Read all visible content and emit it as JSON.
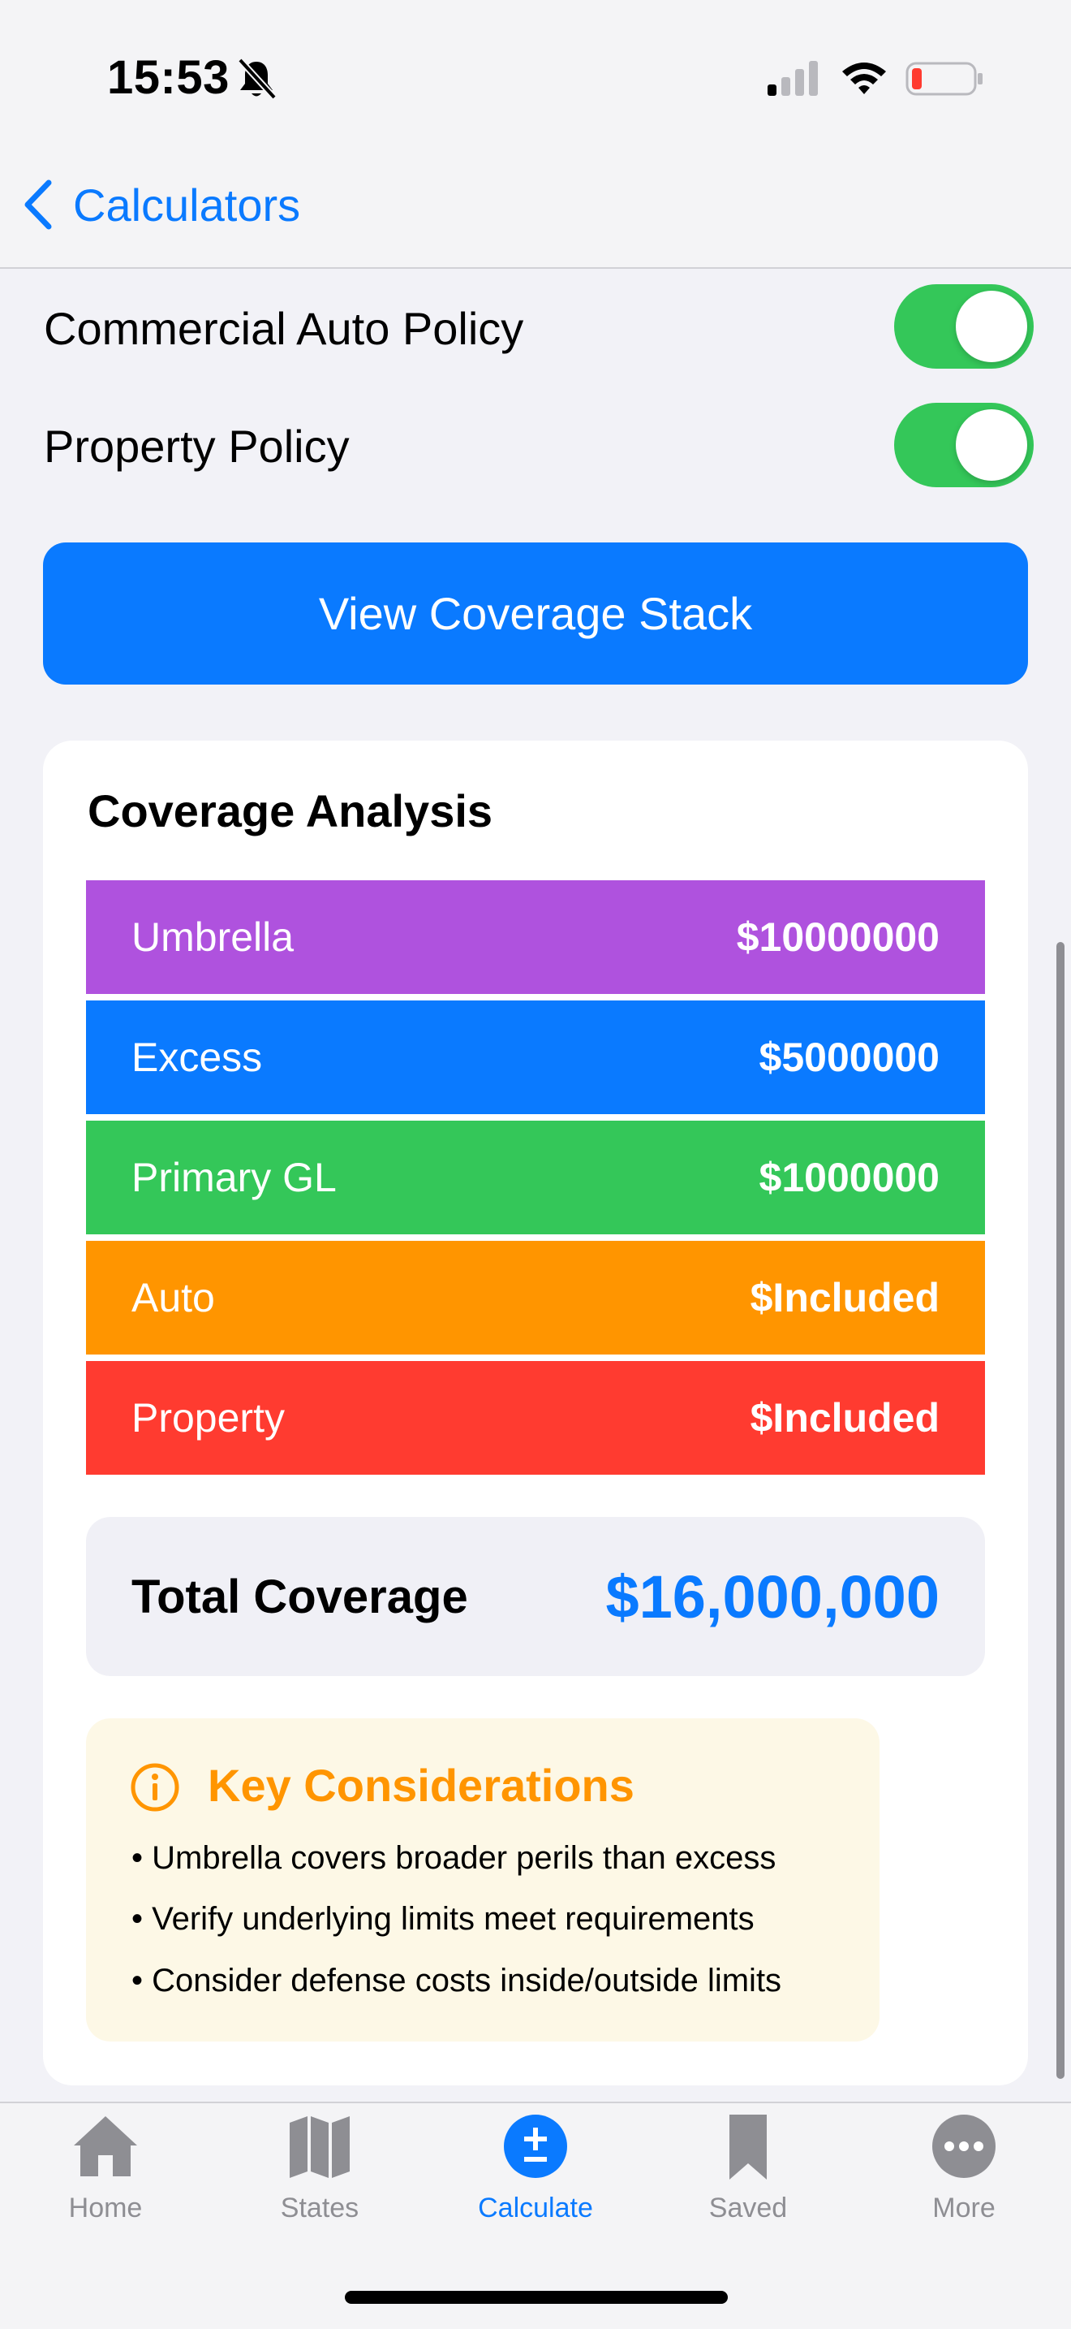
{
  "status_bar": {
    "time": "15:53"
  },
  "nav": {
    "back_label": "Calculators"
  },
  "toggles": [
    {
      "label": "Commercial Auto Policy",
      "on": true
    },
    {
      "label": "Property Policy",
      "on": true
    }
  ],
  "primary_button": {
    "label": "View Coverage Stack"
  },
  "coverage": {
    "title": "Coverage Analysis",
    "layers": [
      {
        "label": "Umbrella",
        "value": "$10000000",
        "color": "#af52de"
      },
      {
        "label": "Excess",
        "value": "$5000000",
        "color": "#0a7aff"
      },
      {
        "label": "Primary GL",
        "value": "$1000000",
        "color": "#34c759"
      },
      {
        "label": "Auto",
        "value": "$Included",
        "color": "#ff9500"
      },
      {
        "label": "Property",
        "value": "$Included",
        "color": "#ff3b30"
      }
    ],
    "total_label": "Total Coverage",
    "total_value": "$16,000,000"
  },
  "considerations": {
    "title": "Key Considerations",
    "items": [
      "• Umbrella covers broader perils than excess",
      "• Verify underlying limits meet requirements",
      "• Consider defense costs inside/outside limits"
    ]
  },
  "tabs": [
    {
      "label": "Home",
      "icon": "house-icon",
      "active": false
    },
    {
      "label": "States",
      "icon": "map-icon",
      "active": false
    },
    {
      "label": "Calculate",
      "icon": "plus-minus-icon",
      "active": true
    },
    {
      "label": "Saved",
      "icon": "bookmark-icon",
      "active": false
    },
    {
      "label": "More",
      "icon": "ellipsis-icon",
      "active": false
    }
  ]
}
